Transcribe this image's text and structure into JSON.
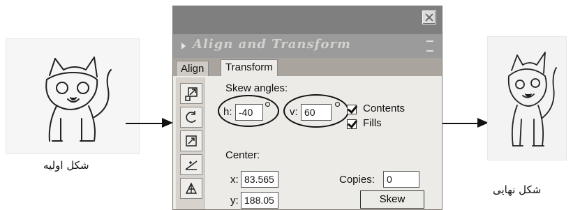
{
  "left_caption": "شکل اولیه",
  "right_caption": "شکل نهایی",
  "panel": {
    "title": "Align and Transform",
    "tabs": [
      "Align",
      "Transform"
    ],
    "skew_label": "Skew angles:",
    "h_label": "h:",
    "h_value": "-40",
    "v_label": "v:",
    "v_value": "60",
    "checkboxes": [
      {
        "label": "Contents",
        "checked": true
      },
      {
        "label": "Fills",
        "checked": true
      }
    ],
    "center_label": "Center:",
    "x_label": "x:",
    "x_value": "83.565",
    "y_label": "y:",
    "y_value": "188.05",
    "copies_label": "Copies:",
    "copies_value": "0",
    "skew_button": "Skew"
  },
  "colors": {
    "panel_bg": "#c4c0b8",
    "content_bg": "#ecebe7",
    "accent": "#111111"
  },
  "icons": [
    "close-icon",
    "scale-icon",
    "rotate-icon",
    "flip-icon",
    "skew-icon",
    "distort-icon"
  ]
}
